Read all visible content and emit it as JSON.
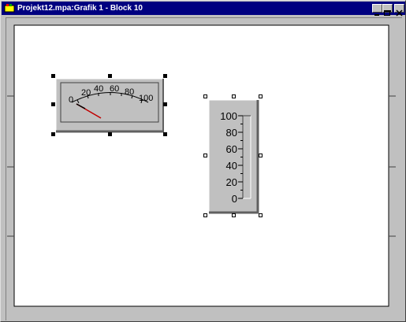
{
  "window": {
    "title": "Projekt12.mpa:Grafik 1 - Block 10",
    "buttons": [
      "minimize",
      "maximize",
      "close"
    ]
  },
  "meter": {
    "scale_labels": [
      "0",
      "20",
      "40",
      "60",
      "80",
      "100"
    ],
    "needle_value": 0,
    "needle_color": "#c00000",
    "selection": "selected"
  },
  "bar_gauge": {
    "scale_labels": [
      "100",
      "80",
      "60",
      "40",
      "20",
      "0"
    ],
    "fill_value": 0,
    "selection": "unselected-handles"
  },
  "colors": {
    "titlebar": "#000080",
    "face": "#c0c0c0",
    "canvas": "#ffffff"
  }
}
